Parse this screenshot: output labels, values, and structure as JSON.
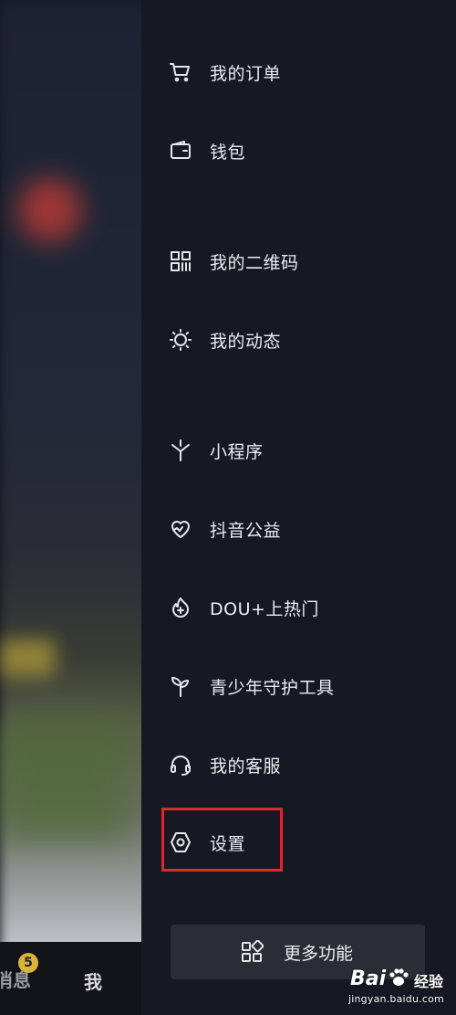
{
  "bottom_nav": {
    "messages_label": "消息",
    "messages_badge": "5",
    "me_label": "我"
  },
  "menu": {
    "items": [
      {
        "label": "我的订单",
        "icon": "cart-icon"
      },
      {
        "label": "钱包",
        "icon": "wallet-icon"
      },
      {
        "label": "我的二维码",
        "icon": "qrcode-icon"
      },
      {
        "label": "我的动态",
        "icon": "sun-icon"
      },
      {
        "label": "小程序",
        "icon": "mini-program-icon"
      },
      {
        "label": "抖音公益",
        "icon": "heart-charity-icon"
      },
      {
        "label": "DOU+上热门",
        "icon": "flame-plus-icon"
      },
      {
        "label": "青少年守护工具",
        "icon": "sprout-icon"
      },
      {
        "label": "我的客服",
        "icon": "headset-icon"
      },
      {
        "label": "设置",
        "icon": "hexagon-gear-icon"
      }
    ]
  },
  "more_button": {
    "label": "更多功能",
    "icon": "grid-icon"
  },
  "watermark": {
    "logo": "Bai",
    "logo_suffix": "经验",
    "url": "jingyan.baidu.com"
  },
  "colors": {
    "drawer_bg": "#161824",
    "highlight": "#e0262a",
    "badge": "#d9b43a"
  }
}
